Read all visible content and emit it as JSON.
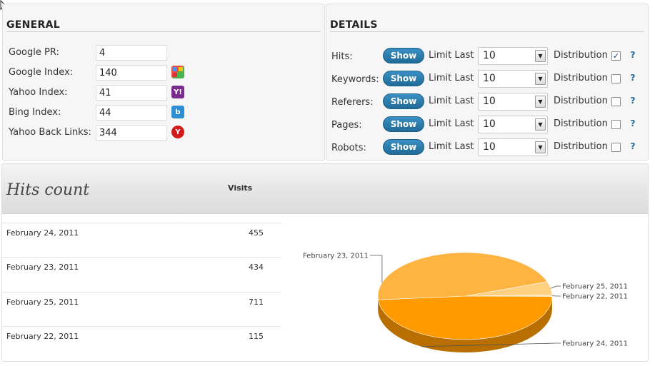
{
  "general": {
    "title": "GENERAL",
    "rows": [
      {
        "label": "Google PR:",
        "value": "4",
        "icon": ""
      },
      {
        "label": "Google Index:",
        "value": "140",
        "icon": "google-icon",
        "icon_color": "#7aa93c"
      },
      {
        "label": "Yahoo Index:",
        "value": "41",
        "icon": "yahoo-icon",
        "icon_color": "#7a2c8e"
      },
      {
        "label": "Bing Index:",
        "value": "44",
        "icon": "bing-icon",
        "icon_color": "#2d8ed1"
      },
      {
        "label": "Yahoo Back Links:",
        "value": "344",
        "icon": "yahoo-backlinks-icon",
        "icon_color": "#d21a1a"
      }
    ]
  },
  "details": {
    "title": "DETAILS",
    "show_label": "Show",
    "limit_label": "Limit Last",
    "distribution_label": "Distribution",
    "help_label": "?",
    "rows": [
      {
        "label": "Hits:",
        "limit": "10",
        "distribution_checked": true
      },
      {
        "label": "Keywords:",
        "limit": "10",
        "distribution_checked": false
      },
      {
        "label": "Referers:",
        "limit": "10",
        "distribution_checked": false
      },
      {
        "label": "Pages:",
        "limit": "10",
        "distribution_checked": false
      },
      {
        "label": "Robots:",
        "limit": "10",
        "distribution_checked": false
      }
    ]
  },
  "hits": {
    "title": "Hits count",
    "visits_header": "Visits",
    "rows": [
      {
        "date": "February 24, 2011",
        "visits": "455"
      },
      {
        "date": "February 23, 2011",
        "visits": "434"
      },
      {
        "date": "February 25, 2011",
        "visits": "711"
      },
      {
        "date": "February 22, 2011",
        "visits": "115"
      }
    ]
  },
  "chart_data": {
    "type": "pie",
    "slices": [
      {
        "label": "February 23, 2011",
        "value": 46.0,
        "color": "#ffb340"
      },
      {
        "label": "February 25, 2011",
        "value": 5.0,
        "color": "#ffd080"
      },
      {
        "label": "February 22, 2011",
        "value": 0.5,
        "color": "#ffe8b8"
      },
      {
        "label": "February 24, 2011",
        "value": 48.5,
        "color": "#ff9a00"
      }
    ]
  }
}
